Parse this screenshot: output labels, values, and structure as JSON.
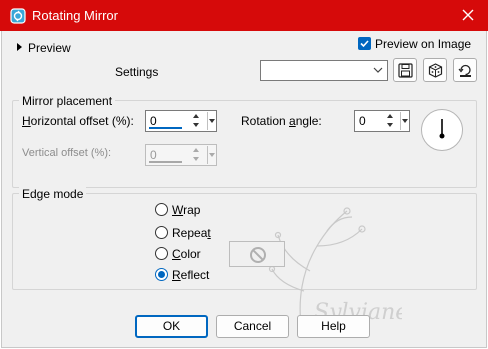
{
  "window": {
    "title": "Rotating Mirror"
  },
  "preview": {
    "label": "Preview",
    "preview_on_image_label": "Preview on Image",
    "preview_on_image_checked": true
  },
  "settings": {
    "label": "Settings",
    "value": ""
  },
  "mirror_placement": {
    "title": "Mirror placement",
    "horizontal": {
      "label_pre": "",
      "label_key": "H",
      "label_post": "orizontal offset (%):",
      "value": "0"
    },
    "vertical": {
      "label": "Vertical offset (%):",
      "value": "0"
    },
    "rotation": {
      "label_pre": "Rotation ",
      "label_key": "a",
      "label_post": "ngle:",
      "value": "0"
    }
  },
  "edge_mode": {
    "title": "Edge mode",
    "options": [
      {
        "pre": "",
        "key": "W",
        "post": "rap",
        "selected": false
      },
      {
        "pre": "Repea",
        "key": "t",
        "post": "",
        "selected": false
      },
      {
        "pre": "",
        "key": "C",
        "post": "olor",
        "selected": false
      },
      {
        "pre": "",
        "key": "R",
        "post": "eflect",
        "selected": true
      }
    ]
  },
  "watermark_text": "Sylviane",
  "buttons": {
    "ok": "OK",
    "cancel": "Cancel",
    "help": "Help"
  },
  "colors": {
    "titlebar": "#d60a0a",
    "accent": "#0067c0",
    "background": "#f0f0f0"
  },
  "icons": [
    "rotating-mirror-app-icon",
    "close-icon",
    "expand-triangle-icon",
    "checkmark-icon",
    "chevron-down-icon",
    "save-disk-icon",
    "dice-icon",
    "reset-defaults-icon",
    "rotation-dial-icon",
    "no-color-icon"
  ]
}
